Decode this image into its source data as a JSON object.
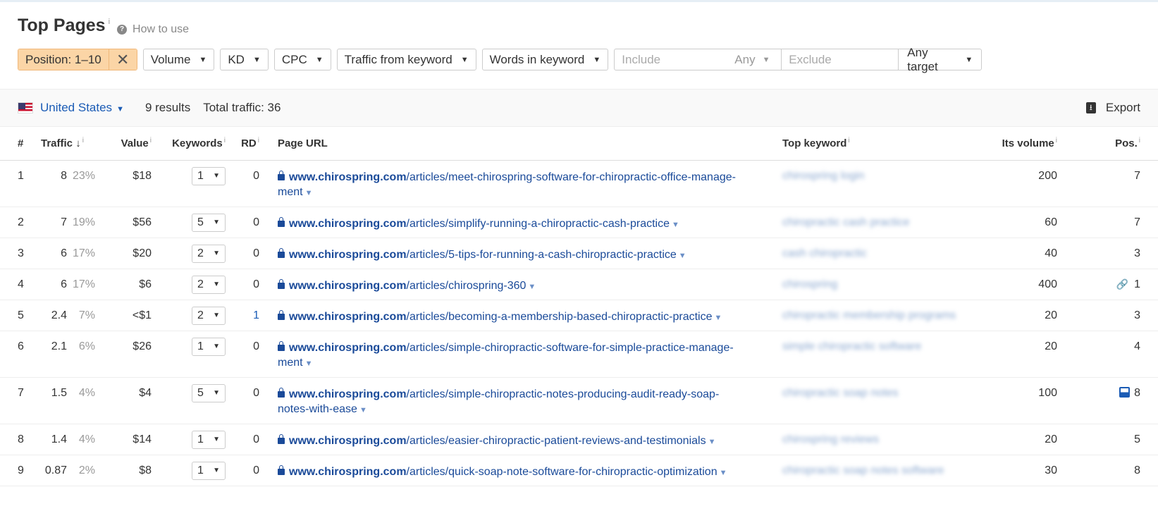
{
  "header": {
    "title": "Top Pages",
    "info": "i",
    "help_label": "How to use",
    "help_icon": "?"
  },
  "filters": {
    "position_label": "Position: 1–10",
    "position_clear": "✕",
    "volume": "Volume",
    "kd": "KD",
    "cpc": "CPC",
    "traffic_from_keyword": "Traffic from keyword",
    "words_in_keyword": "Words in keyword",
    "include_placeholder": "Include",
    "any_label": "Any",
    "exclude_placeholder": "Exclude",
    "target_label": "Any target",
    "caret": "▼"
  },
  "toolbar": {
    "country": "United States",
    "results": "9 results",
    "total_traffic": "Total traffic: 36",
    "export": "Export"
  },
  "columns": {
    "num": "#",
    "traffic": "Traffic",
    "traffic_sort": "↓",
    "value": "Value",
    "keywords": "Keywords",
    "rd": "RD",
    "page_url": "Page URL",
    "top_keyword": "Top keyword",
    "its_volume": "Its volume",
    "pos": "Pos.",
    "info": "i"
  },
  "rows": [
    {
      "num": "1",
      "traffic": "8",
      "share": "23%",
      "value": "$18",
      "keywords": "1",
      "rd": "0",
      "domain": "www.chirospring.com",
      "path": "/articles/meet-chirospring-software-for-chiropractic-office-manage-",
      "path2": "ment",
      "top_keyword": "chirospring login",
      "volume": "200",
      "pos": "7"
    },
    {
      "num": "2",
      "traffic": "7",
      "share": "19%",
      "value": "$56",
      "keywords": "5",
      "rd": "0",
      "domain": "www.chirospring.com",
      "path": "/articles/simplify-running-a-chiropractic-cash-practice",
      "path2": "",
      "top_keyword": "chiropractic cash practice",
      "volume": "60",
      "pos": "7"
    },
    {
      "num": "3",
      "traffic": "6",
      "share": "17%",
      "value": "$20",
      "keywords": "2",
      "rd": "0",
      "domain": "www.chirospring.com",
      "path": "/articles/5-tips-for-running-a-cash-chiropractic-practice",
      "path2": "",
      "top_keyword": "cash chiropractic",
      "volume": "40",
      "pos": "3"
    },
    {
      "num": "4",
      "traffic": "6",
      "share": "17%",
      "value": "$6",
      "keywords": "2",
      "rd": "0",
      "domain": "www.chirospring.com",
      "path": "/articles/chirospring-360",
      "path2": "",
      "top_keyword": "chirospring",
      "volume": "400",
      "pos": "1"
    },
    {
      "num": "5",
      "traffic": "2.4",
      "share": "7%",
      "value": "<$1",
      "keywords": "2",
      "rd": "1",
      "domain": "www.chirospring.com",
      "path": "/articles/becoming-a-membership-based-chiropractic-practice",
      "path2": "",
      "top_keyword": "chiropractic membership programs",
      "volume": "20",
      "pos": "3"
    },
    {
      "num": "6",
      "traffic": "2.1",
      "share": "6%",
      "value": "$26",
      "keywords": "1",
      "rd": "0",
      "domain": "www.chirospring.com",
      "path": "/articles/simple-chiropractic-software-for-simple-practice-manage-",
      "path2": "ment",
      "top_keyword": "simple chiropractic software",
      "volume": "20",
      "pos": "4"
    },
    {
      "num": "7",
      "traffic": "1.5",
      "share": "4%",
      "value": "$4",
      "keywords": "5",
      "rd": "0",
      "domain": "www.chirospring.com",
      "path": "/articles/simple-chiropractic-notes-producing-audit-ready-soap-",
      "path2": "notes-with-ease",
      "top_keyword": "chiropractic soap notes",
      "volume": "100",
      "pos": "8"
    },
    {
      "num": "8",
      "traffic": "1.4",
      "share": "4%",
      "value": "$14",
      "keywords": "1",
      "rd": "0",
      "domain": "www.chirospring.com",
      "path": "/articles/easier-chiropractic-patient-reviews-and-testimonials",
      "path2": "",
      "top_keyword": "chirospring reviews",
      "volume": "20",
      "pos": "5"
    },
    {
      "num": "9",
      "traffic": "0.87",
      "share": "2%",
      "value": "$8",
      "keywords": "1",
      "rd": "0",
      "domain": "www.chirospring.com",
      "path": "/articles/quick-soap-note-software-for-chiropractic-optimization",
      "path2": "",
      "top_keyword": "chiropractic soap notes software",
      "volume": "30",
      "pos": "8"
    }
  ]
}
